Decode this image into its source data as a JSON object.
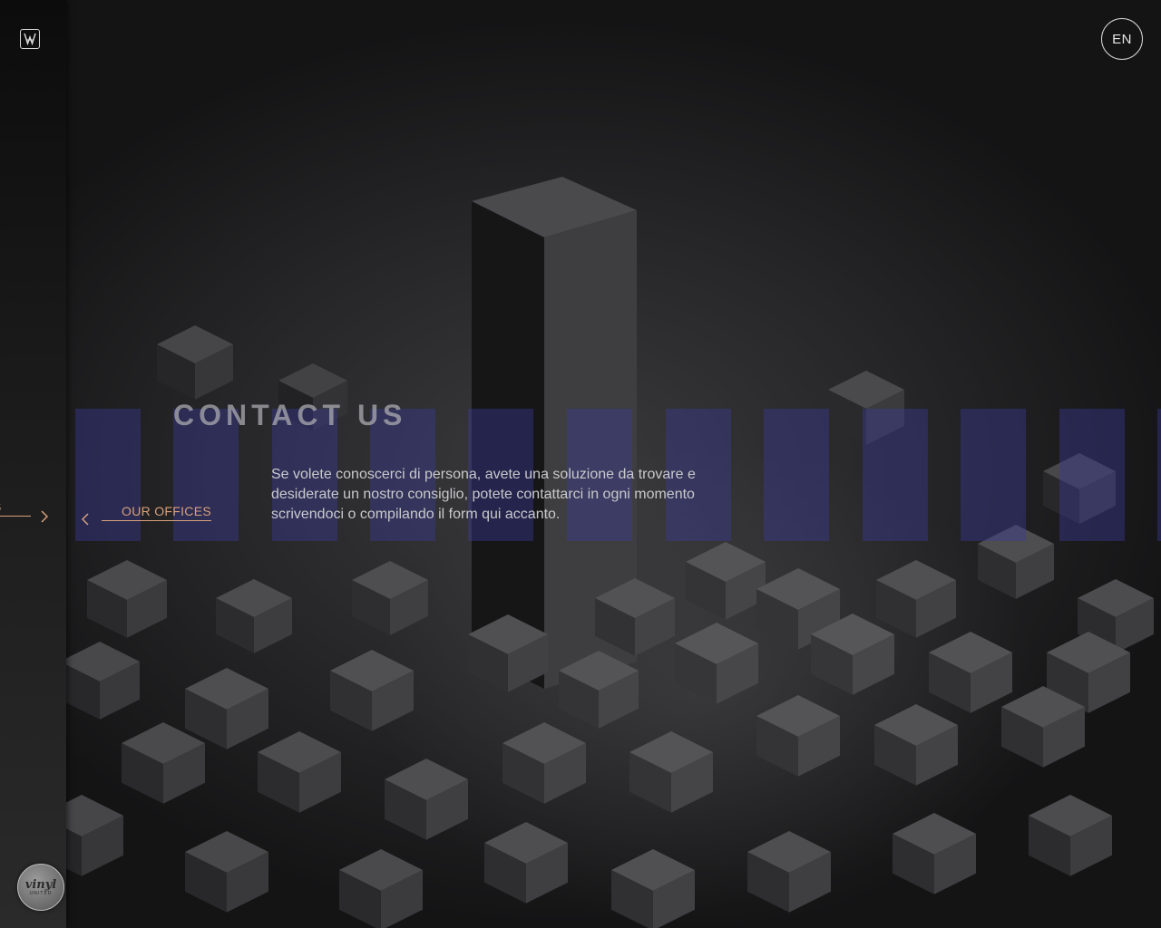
{
  "header": {
    "language_label": "EN"
  },
  "page": {
    "title": "CONTACT US",
    "intro": "Se volete conoscerci di persona, avete una soluzione da trovare e desiderate un nostro consiglio, potete contattarci in ogni momento scrivendoci o compilando il form qui accanto."
  },
  "nav": {
    "prev_label": "OUR OFFICES",
    "next_label_fragment": "S"
  },
  "sidebar": {
    "badge_line1": "vinyl",
    "badge_line2": "UNITED"
  },
  "colors": {
    "accent": "#d8a07c",
    "stripe": "#3a3a96",
    "sidebar_bg": "#1a1a1a",
    "text": "#c9c9cc"
  },
  "icons": [
    "logo-icon",
    "chevron-left-icon",
    "chevron-right-icon"
  ]
}
